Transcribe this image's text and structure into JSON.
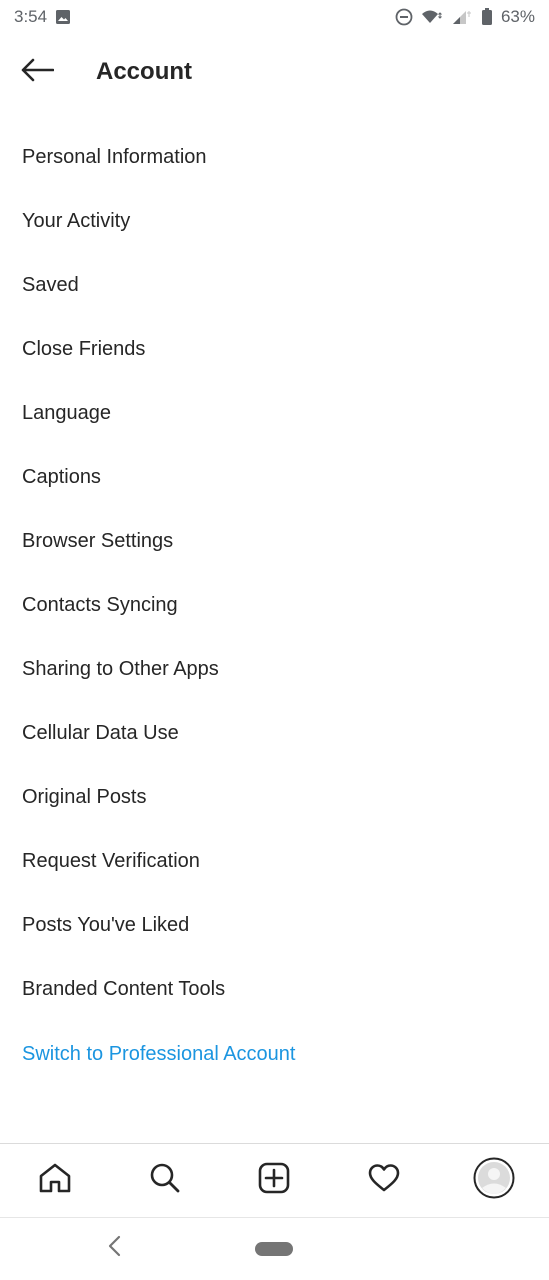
{
  "status_bar": {
    "time": "3:54",
    "battery": "63%",
    "icons": [
      "image-icon",
      "dnd-icon",
      "wifi-icon",
      "signal-icon",
      "battery-icon"
    ]
  },
  "header": {
    "title": "Account",
    "back_icon": "arrow-left-icon"
  },
  "menu": {
    "items": [
      {
        "label": "Personal Information"
      },
      {
        "label": "Your Activity"
      },
      {
        "label": "Saved"
      },
      {
        "label": "Close Friends"
      },
      {
        "label": "Language"
      },
      {
        "label": "Captions"
      },
      {
        "label": "Browser Settings"
      },
      {
        "label": "Contacts Syncing"
      },
      {
        "label": "Sharing to Other Apps"
      },
      {
        "label": "Cellular Data Use"
      },
      {
        "label": "Original Posts"
      },
      {
        "label": "Request Verification"
      },
      {
        "label": "Posts You've Liked"
      },
      {
        "label": "Branded Content Tools"
      }
    ],
    "professional_link": "Switch to Professional Account"
  },
  "bottom_nav": {
    "icons": [
      "home-icon",
      "search-icon",
      "add-post-icon",
      "heart-icon",
      "profile-avatar-icon"
    ]
  },
  "system_nav": {
    "icons": [
      "system-back-icon",
      "system-home-pill"
    ]
  },
  "colors": {
    "text": "#262626",
    "link": "#1b95e0",
    "status_text": "#5f6368",
    "divider": "#dbdbdb"
  }
}
